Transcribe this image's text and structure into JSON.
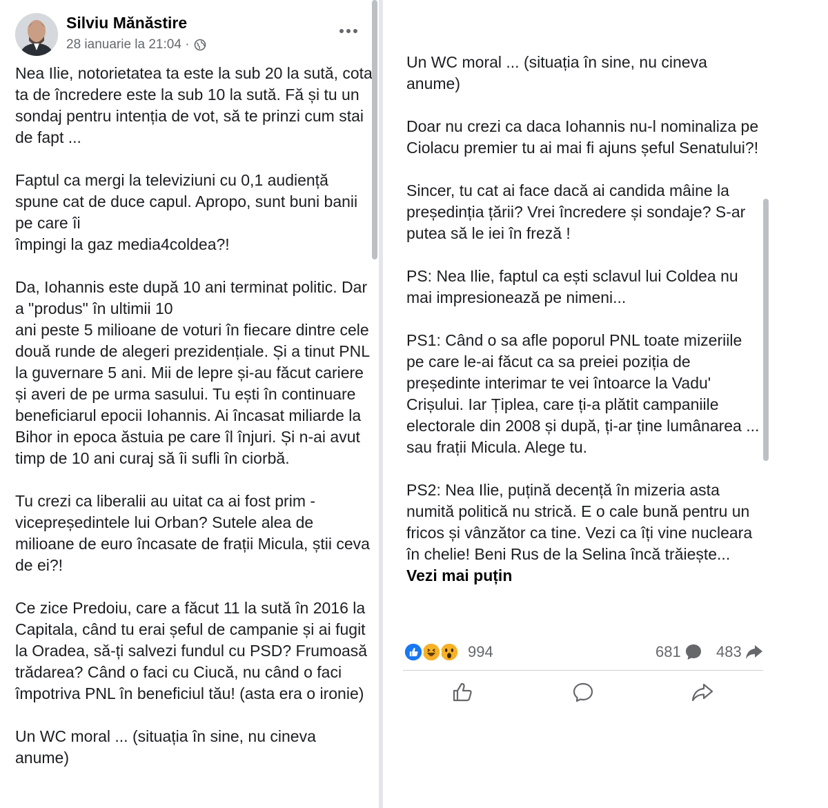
{
  "post": {
    "author": "Silviu Mănăstire",
    "timestamp": "28 ianuarie la 21:04 ·",
    "privacy_icon": "globe-icon",
    "left_paragraphs": [
      "Nea Ilie, notorietatea ta este la sub 20 la sută, cota ta de încredere este la sub 10 la sută. Fă și tu un sondaj pentru intenția de vot, să te prinzi cum stai de fapt ...",
      "Faptul ca mergi la televiziuni cu 0,1 audiență spune cat de duce capul. Apropo, sunt buni banii pe care îi\nîmpingi la gaz media4coldea?!",
      "Da, Iohannis este după 10 ani terminat politic. Dar a \"produs\" în ultimii 10\nani peste 5 milioane de voturi în fiecare dintre cele două runde de alegeri prezidențiale. Și a tinut PNL la guvernare 5 ani. Mii de lepre și-au făcut cariere și averi de pe urma sasului. Tu ești în continuare beneficiarul epocii Iohannis. Ai încasat miliarde la Bihor in epoca ăstuia pe care îl înjuri. Și n-ai avut timp de 10 ani curaj să îi sufli în ciorbă.",
      "Tu crezi ca liberalii au uitat ca ai fost prim - vicepreședintele lui Orban? Sutele alea de milioane de euro încasate de frații Micula, știi ceva de ei?!",
      "Ce zice Predoiu, care a făcut 11 la sută în 2016 la Capitala, când tu erai șeful de campanie și ai fugit la Oradea, să-ți salvezi fundul cu PSD? Frumoasă trădarea? Când o faci cu Ciucă, nu când o faci împotriva PNL în beneficiul tău! (asta era o ironie)",
      "Un WC moral ... (situația în sine, nu cineva anume)"
    ],
    "right_paragraphs": [
      "Un WC moral ... (situația în sine, nu cineva anume)",
      "Doar nu crezi ca daca Iohannis nu-l nominaliza pe Ciolacu premier tu ai mai fi ajuns șeful Senatului?!",
      "Sincer, tu cat ai face dacă ai candida mâine la președinția țării? Vrei încredere și sondaje? S-ar putea să le iei în freză !",
      "PS: Nea Ilie, faptul ca ești sclavul lui Coldea nu mai impresionează pe nimeni...",
      "PS1: Când o sa afle poporul PNL toate mizeriile pe care le-ai făcut ca sa preiei poziția de președinte interimar te vei întoarce la Vadu' Crișului. Iar Țiplea, care ți-a plătit campaniile electorale din 2008 și după, ți-ar ține lumânarea ... sau frații Micula. Alege tu.",
      "PS2: Nea Ilie, puțină decență în mizeria asta numită politică nu strică. E o cale bună pentru un fricos și vânzător ca tine. Vezi ca îți vine nucleara în chelie! Beni Rus de la Selina încă trăiește..."
    ],
    "see_less_label": "Vezi mai puțin"
  },
  "engagement": {
    "reaction_icons": [
      "like-icon",
      "haha-icon",
      "wow-icon"
    ],
    "reaction_count": "994",
    "comment_count": "681",
    "share_count": "483"
  },
  "actions": {
    "like_icon": "thumbs-up-icon",
    "comment_icon": "comment-bubble-icon",
    "share_icon": "share-arrow-icon"
  },
  "colors": {
    "like_blue": "#1877f2",
    "reaction_yellow": "#f7b125",
    "meta_gray": "#65676b",
    "text": "#1c1e21"
  }
}
